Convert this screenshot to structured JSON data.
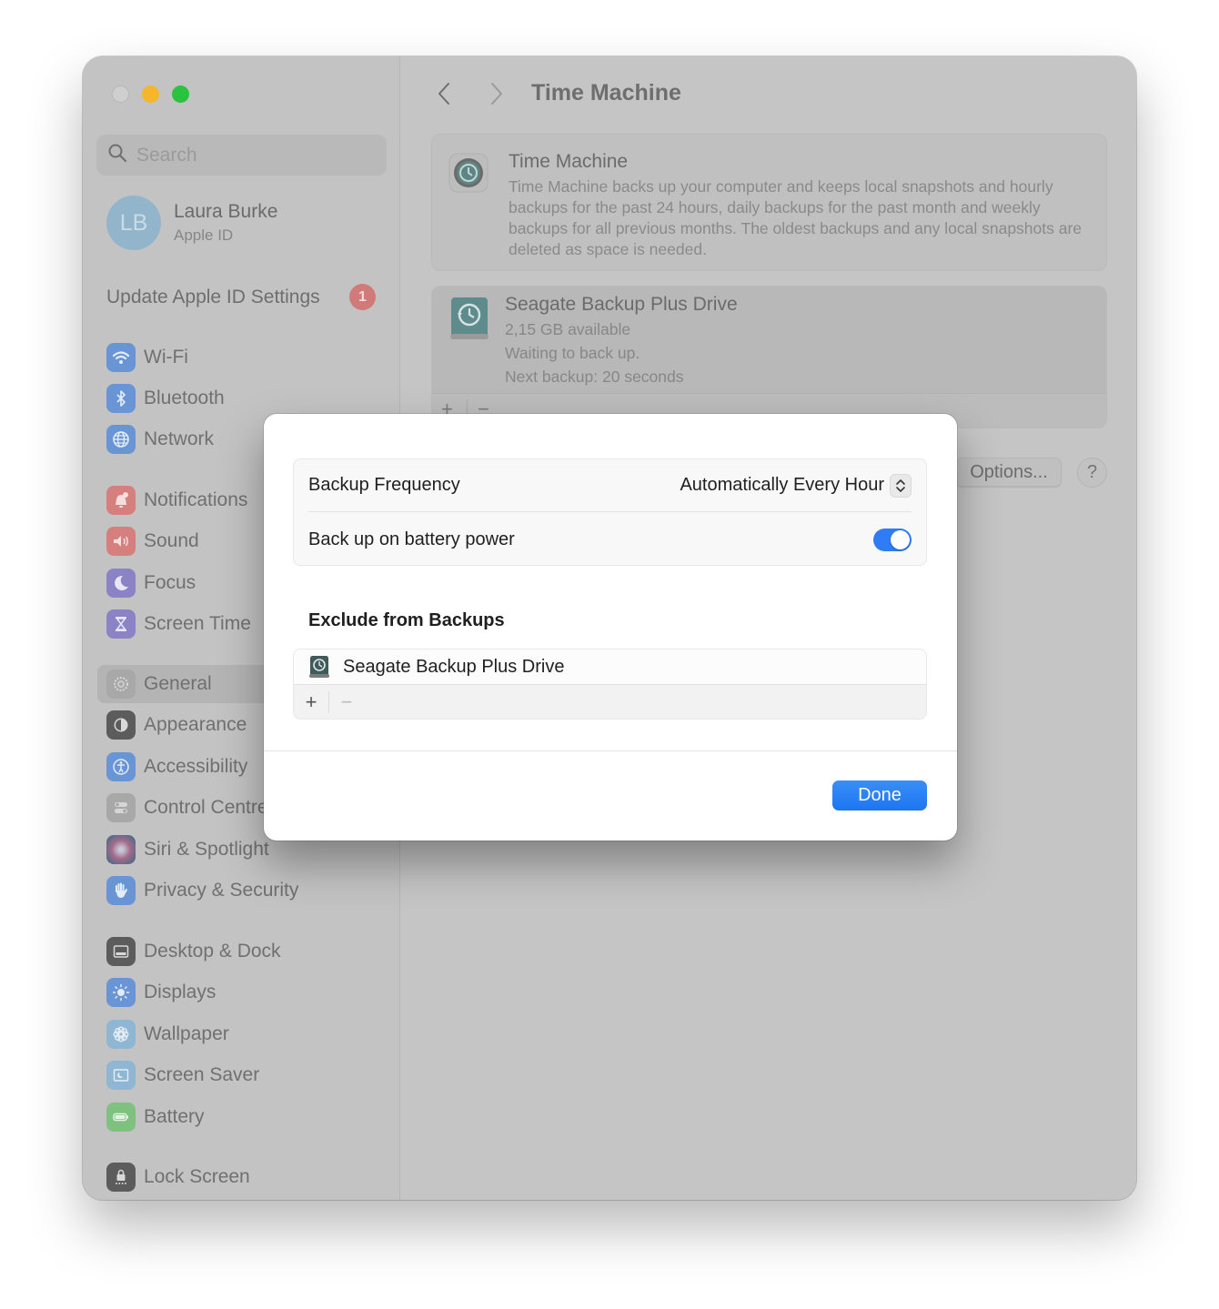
{
  "window": {
    "traffic_lights": [
      "close",
      "minimize",
      "maximize"
    ]
  },
  "sidebar": {
    "search_placeholder": "Search",
    "profile": {
      "initials": "LB",
      "name": "Laura Burke",
      "subtitle": "Apple ID"
    },
    "update_prompt": {
      "label": "Update Apple ID Settings",
      "badge": "1"
    },
    "items": [
      {
        "label": "Wi-Fi",
        "icon": "wifi-icon",
        "color": "#6a95d4"
      },
      {
        "label": "Bluetooth",
        "icon": "bluetooth-icon",
        "color": "#6a95d4"
      },
      {
        "label": "Network",
        "icon": "globe-icon",
        "color": "#6a95d4"
      },
      {
        "label": "Notifications",
        "icon": "bell-icon",
        "color": "#d67f7f"
      },
      {
        "label": "Sound",
        "icon": "speaker-icon",
        "color": "#d67f7f"
      },
      {
        "label": "Focus",
        "icon": "moon-icon",
        "color": "#8a83c6"
      },
      {
        "label": "Screen Time",
        "icon": "hourglass-icon",
        "color": "#8a83c6"
      },
      {
        "label": "General",
        "icon": "gear-icon",
        "color": "#a8a8a8",
        "selected": true
      },
      {
        "label": "Appearance",
        "icon": "appearance-icon",
        "color": "#5c5c5c"
      },
      {
        "label": "Accessibility",
        "icon": "accessibility-icon",
        "color": "#6a95d4"
      },
      {
        "label": "Control Centre",
        "icon": "toggles-icon",
        "color": "#a8a8a8"
      },
      {
        "label": "Siri & Spotlight",
        "icon": "siri-icon",
        "color": "#7a6a8a"
      },
      {
        "label": "Privacy & Security",
        "icon": "hand-icon",
        "color": "#6a95d4"
      },
      {
        "label": "Desktop & Dock",
        "icon": "dock-icon",
        "color": "#5c5c5c"
      },
      {
        "label": "Displays",
        "icon": "sun-icon",
        "color": "#6a95d4"
      },
      {
        "label": "Wallpaper",
        "icon": "flower-icon",
        "color": "#8fb6d2"
      },
      {
        "label": "Screen Saver",
        "icon": "screensaver-icon",
        "color": "#8fb6d2"
      },
      {
        "label": "Battery",
        "icon": "battery-icon",
        "color": "#7fc27f"
      },
      {
        "label": "Lock Screen",
        "icon": "lock-icon",
        "color": "#5c5c5c"
      }
    ]
  },
  "main": {
    "title": "Time Machine",
    "info_card": {
      "title": "Time Machine",
      "description": "Time Machine backs up your computer and keeps local snapshots and hourly backups for the past 24 hours, daily backups for the past month and weekly backups for all previous months. The oldest backups and any local snapshots are deleted as space is needed."
    },
    "drive_card": {
      "name": "Seagate Backup Plus Drive",
      "available": "2,15 GB available",
      "status": "Waiting to back up.",
      "next_backup": "Next backup: 20 seconds"
    },
    "add_label": "+",
    "remove_label": "−",
    "options_label": "Options...",
    "help_label": "?"
  },
  "sheet": {
    "frequency_label": "Backup Frequency",
    "frequency_value": "Automatically Every Hour",
    "battery_label": "Back up on battery power",
    "battery_enabled": true,
    "exclude_title": "Exclude from Backups",
    "excluded_items": [
      "Seagate Backup Plus Drive"
    ],
    "add_label": "+",
    "remove_label": "−",
    "done_label": "Done",
    "accent": "#1f78f3"
  }
}
